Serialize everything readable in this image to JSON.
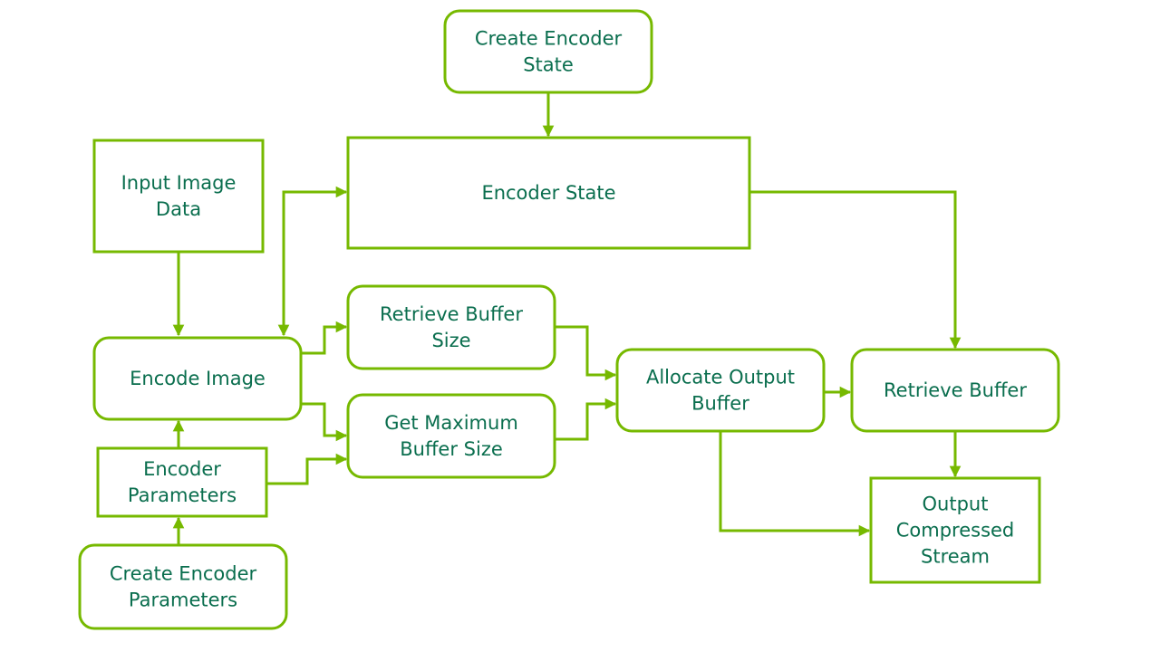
{
  "diagram": {
    "colors": {
      "stroke": "#76b900",
      "text": "#0a6e4e",
      "background": "#ffffff"
    },
    "nodes": [
      {
        "id": "create-encoder-state",
        "shape": "rounded",
        "lines": [
          "Create Encoder",
          "State"
        ]
      },
      {
        "id": "encoder-state",
        "shape": "rect",
        "lines": [
          "Encoder State"
        ]
      },
      {
        "id": "input-image-data",
        "shape": "rect",
        "lines": [
          "Input Image",
          "Data"
        ]
      },
      {
        "id": "encode-image",
        "shape": "rounded",
        "lines": [
          "Encode Image"
        ]
      },
      {
        "id": "retrieve-buffer-size",
        "shape": "rounded",
        "lines": [
          "Retrieve Buffer",
          "Size"
        ]
      },
      {
        "id": "get-maximum-buffer-size",
        "shape": "rounded",
        "lines": [
          "Get Maximum",
          "Buffer Size"
        ]
      },
      {
        "id": "encoder-parameters",
        "shape": "rect",
        "lines": [
          "Encoder",
          "Parameters"
        ]
      },
      {
        "id": "create-encoder-parameters",
        "shape": "rounded",
        "lines": [
          "Create Encoder",
          "Parameters"
        ]
      },
      {
        "id": "allocate-output-buffer",
        "shape": "rounded",
        "lines": [
          "Allocate Output",
          "Buffer"
        ]
      },
      {
        "id": "retrieve-buffer",
        "shape": "rounded",
        "lines": [
          "Retrieve Buffer"
        ]
      },
      {
        "id": "output-compressed-stream",
        "shape": "rect",
        "lines": [
          "Output",
          "Compressed",
          "Stream"
        ]
      }
    ],
    "edges": [
      {
        "from": "create-encoder-state",
        "to": "encoder-state"
      },
      {
        "from": "input-image-data",
        "to": "encode-image"
      },
      {
        "from": "encode-image",
        "to": "encoder-state",
        "bidirectional": true
      },
      {
        "from": "encode-image",
        "to": "retrieve-buffer-size"
      },
      {
        "from": "encode-image",
        "to": "get-maximum-buffer-size"
      },
      {
        "from": "encoder-parameters",
        "to": "encode-image"
      },
      {
        "from": "encoder-parameters",
        "to": "get-maximum-buffer-size"
      },
      {
        "from": "create-encoder-parameters",
        "to": "encoder-parameters"
      },
      {
        "from": "retrieve-buffer-size",
        "to": "allocate-output-buffer"
      },
      {
        "from": "get-maximum-buffer-size",
        "to": "allocate-output-buffer"
      },
      {
        "from": "allocate-output-buffer",
        "to": "retrieve-buffer"
      },
      {
        "from": "encoder-state",
        "to": "retrieve-buffer"
      },
      {
        "from": "retrieve-buffer",
        "to": "output-compressed-stream"
      },
      {
        "from": "allocate-output-buffer",
        "to": "output-compressed-stream"
      }
    ]
  }
}
